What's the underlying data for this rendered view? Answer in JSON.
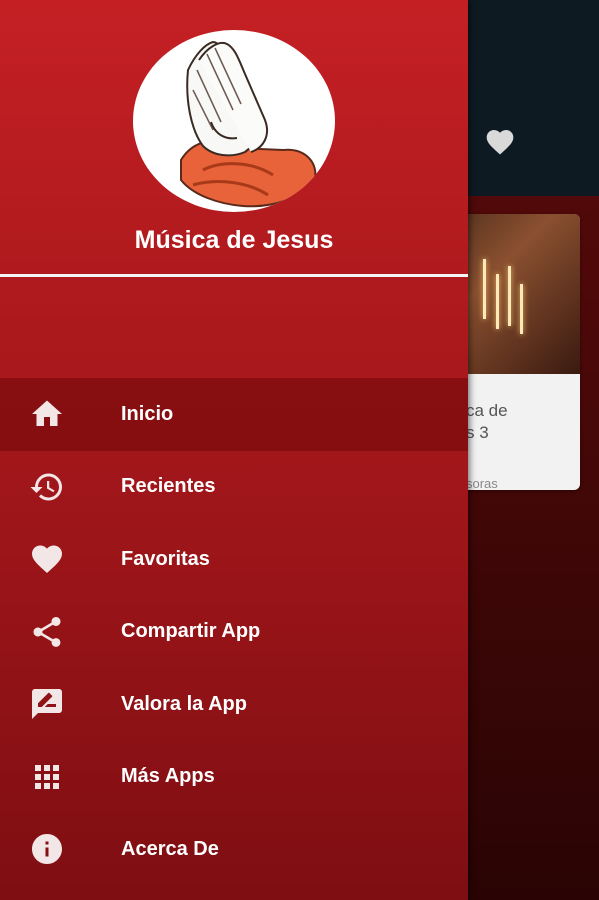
{
  "background_app": {
    "card_title": "ca de\ns 3",
    "card_subtitle": "soras"
  },
  "drawer": {
    "app_name": "Música de Jesus",
    "logo_icon": "praying-hands-icon",
    "menu": [
      {
        "label": "Inicio",
        "icon": "home-icon",
        "active": true
      },
      {
        "label": "Recientes",
        "icon": "history-icon",
        "active": false
      },
      {
        "label": "Favoritas",
        "icon": "heart-icon",
        "active": false
      },
      {
        "label": "Compartir App",
        "icon": "share-icon",
        "active": false
      },
      {
        "label": "Valora la App",
        "icon": "rate-icon",
        "active": false
      },
      {
        "label": "Más Apps",
        "icon": "apps-grid-icon",
        "active": false
      },
      {
        "label": "Acerca De",
        "icon": "info-icon",
        "active": false
      }
    ]
  },
  "colors": {
    "drawer_top": "#c42024",
    "drawer_bottom": "#7e0e12",
    "toolbar": "#0e1a22",
    "icon": "#f2e6e6"
  }
}
